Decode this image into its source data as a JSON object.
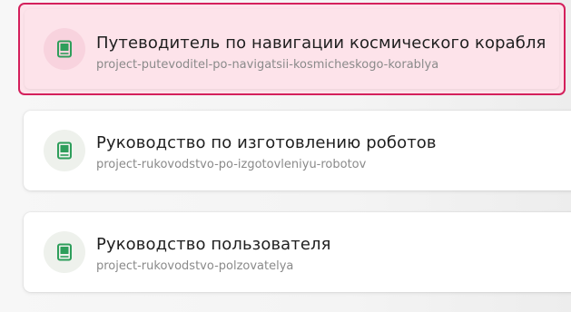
{
  "colors": {
    "accent": "#d4205c",
    "selected_bg": "#fde3ea",
    "icon_green": "#2e9e5b"
  },
  "projects": [
    {
      "title": "Путеводитель по навигации космического корабля",
      "slug": "project-putevoditel-po-navigatsii-kosmicheskogo-korablya",
      "icon": "book-icon",
      "selected": true
    },
    {
      "title": "Руководство по изготовлению роботов",
      "slug": "project-rukovodstvo-po-izgotovleniyu-robotov",
      "icon": "book-icon",
      "selected": false
    },
    {
      "title": "Руководство пользователя",
      "slug": "project-rukovodstvo-polzovatelya",
      "icon": "book-icon",
      "selected": false
    }
  ]
}
